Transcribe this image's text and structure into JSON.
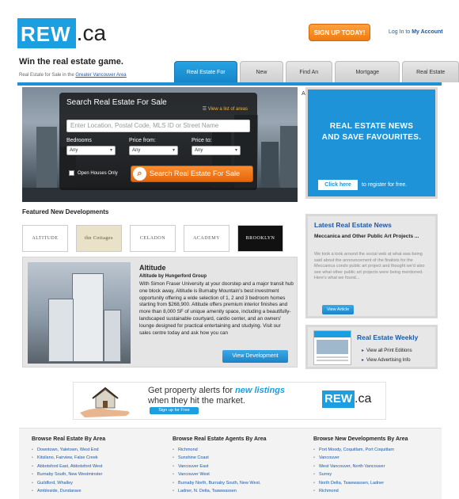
{
  "brand": {
    "rew": "REW",
    "ca": ".ca"
  },
  "header": {
    "signup_label": "SIGN UP TODAY!",
    "login_prefix": "Log In to ",
    "login_link": "My Account",
    "tagline": "Win the real estate game.",
    "crumb_prefix": "Real Estate for Sale in the ",
    "crumb_link": "Greater Vancouver Area"
  },
  "tabs": [
    "Real Estate For Sale",
    "New Homes",
    "Find An Agent",
    "Mortgage Information",
    "Real Estate News"
  ],
  "search": {
    "title": "Search Real Estate For Sale",
    "map_link": "View a list of areas",
    "placeholder": "Enter Location, Postal Code, MLS ID or Street Name",
    "bedrooms_label": "Bedrooms",
    "price_from_label": "Price from:",
    "price_to_label": "Price to:",
    "bedrooms_value": "Any",
    "price_from_value": "Any",
    "price_to_value": "Any",
    "open_houses_label": "Open Houses Only",
    "button_label": "Search Real Estate For Sale"
  },
  "promo": {
    "line1": "REAL ESTATE NEWS",
    "line2": "AND SAVE FAVOURITES.",
    "click_label": "Click here",
    "register_text": "to register for free."
  },
  "featured": {
    "title": "Featured New Developments",
    "logos": [
      "ALTITUDE",
      "the Cottages",
      "CELADON",
      "ACADEMY",
      "BROOKLYN"
    ],
    "name": "Altitude",
    "by": "Altitude by Hungerford Group",
    "description": "With Simon Fraser University at your doorstep and a major transit hub one block away, Altitude is Burnaby Mountain's best investment opportunity offering a wide selection of 1, 2 and 3 bedroom homes starting from $268,900. Altitude offers premium interior finishes and more than 8,000 SF of unique amenity space, including a beautifully-landscaped sustainable courtyard, cardio center, and an owners' lounge designed for practical entertaining and studying. Visit our sales centre today and ask how you can",
    "button_label": "View Development"
  },
  "news": {
    "title": "Latest Real Estate News",
    "headline": "Meccanica and Other Public Art Projects ...",
    "body": "We took a look around the social web at what was being said about the announcement of the finalists for the Meccanica condo public art project and thought we'd also see what other public art projects were being mentioned. Here's what we found...",
    "button_label": "View Article"
  },
  "weekly": {
    "title": "Real Estate Weekly",
    "link1": "View all Print Editions",
    "link2": "View Advertising Info"
  },
  "banner": {
    "line1_a": "Get property alerts for ",
    "line1_b": "new listings",
    "line2": "when they hit the market.",
    "button_label": "Sign up for Free"
  },
  "browse": [
    {
      "title": "Browse Real Estate By Area",
      "items": [
        "Downtown, Yaletown, West End",
        "Kitsilano, Fairview, False Creek",
        "Abbotsford East, Abbotsford West",
        "Burnaby South, New Westminster",
        "Guildford, Whalley",
        "Ambleside, Dundarave"
      ]
    },
    {
      "title": "Browse Real Estate Agents By Area",
      "items": [
        "Richmond",
        "Sunshine Coast",
        "Vancouver East",
        "Vancouver West",
        "Burnaby North, Burnaby South, New West.",
        "Ladner, N. Delta, Tsawwassen"
      ]
    },
    {
      "title": "Browse New Developments By Area",
      "items": [
        "Port Moody, Coquitlam, Port Coquitlam",
        "Vancouver",
        "West Vancouver, North Vancouver",
        "Surrey",
        "North Delta, Tsawwassen, Ladner",
        "Richmond"
      ]
    }
  ],
  "colors": {
    "accent": "#1b9fe0",
    "orange": "#f07a12"
  }
}
